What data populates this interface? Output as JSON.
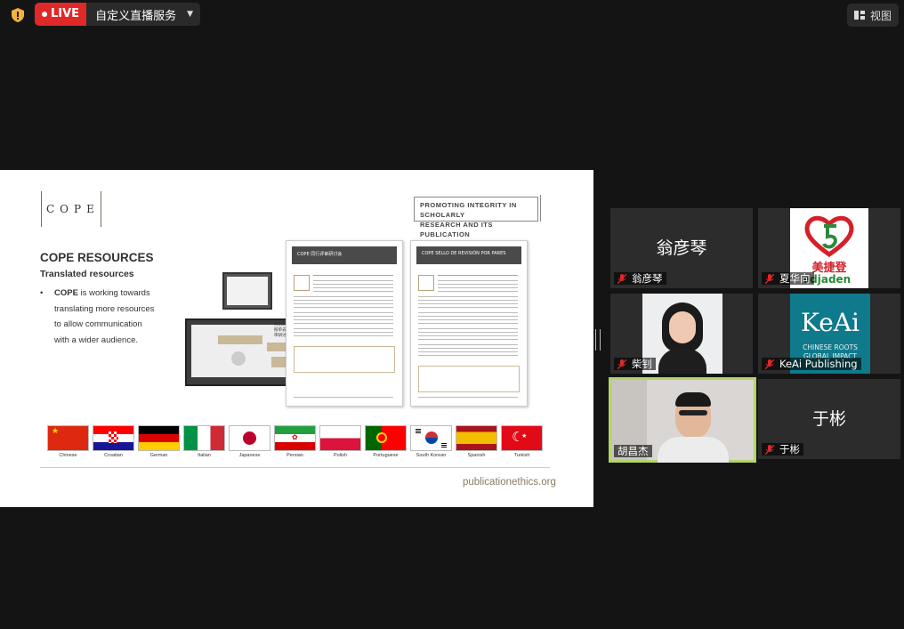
{
  "topbar": {
    "live_label": "LIVE",
    "stream_title": "自定义直播服务",
    "view_label": "视图",
    "colors": {
      "live": "#e02828",
      "shield": "#f2b23b"
    }
  },
  "slide": {
    "logo_text": "COPE",
    "promo_line1": "PROMOTING INTEGRITY IN SCHOLARLY",
    "promo_line2": "RESEARCH AND ITS PUBLICATION",
    "resources_title": "COPE RESOURCES",
    "resources_subtitle": "Translated resources",
    "bullet": "•",
    "bullet_bold": "COPE",
    "bullet_line1": " is working towards",
    "bullet_line2": "translating more resources",
    "bullet_line3": "to allow communication",
    "bullet_line4": "with a wider audience.",
    "doc1_header": "COPE 同行评审研讨会",
    "doc2_header": "COPE SELLO DE REVISIÓN POR PARES",
    "laptop2_caption": "共用COPE同\n照单去同行评\n审研讨会",
    "flags": [
      {
        "label": "Chinese",
        "icon": "china-flag"
      },
      {
        "label": "Croatian",
        "icon": "croatia-flag"
      },
      {
        "label": "German",
        "icon": "germany-flag"
      },
      {
        "label": "Italian",
        "icon": "italy-flag"
      },
      {
        "label": "Japanese",
        "icon": "japan-flag"
      },
      {
        "label": "Persian",
        "icon": "iran-flag"
      },
      {
        "label": "Polish",
        "icon": "poland-flag"
      },
      {
        "label": "Portuguese",
        "icon": "portugal-flag"
      },
      {
        "label": "South Korean",
        "icon": "south-korea-flag"
      },
      {
        "label": "Spanish",
        "icon": "spain-flag"
      },
      {
        "label": "Turkish",
        "icon": "turkey-flag"
      }
    ],
    "website": "publicationethics.org"
  },
  "participants": [
    {
      "name": "翁彦琴",
      "display": "翁彦琴",
      "type": "text",
      "muted": true
    },
    {
      "name": "夏华向",
      "display": "美捷登",
      "logo_sub": "edjaden",
      "type": "logo-medjaden",
      "muted": true
    },
    {
      "name": "柴钊",
      "type": "photo",
      "muted": true
    },
    {
      "name": "KeAi Publishing",
      "logo_main": "KeAi",
      "logo_sub1": "CHINESE ROOTS",
      "logo_sub2": "GLOBAL IMPACT",
      "type": "logo-keai",
      "muted": true
    },
    {
      "name": "胡昌杰",
      "type": "photo-active",
      "muted": false,
      "active": true
    },
    {
      "name": "于彬",
      "display": "于彬",
      "type": "text",
      "muted": true
    }
  ]
}
